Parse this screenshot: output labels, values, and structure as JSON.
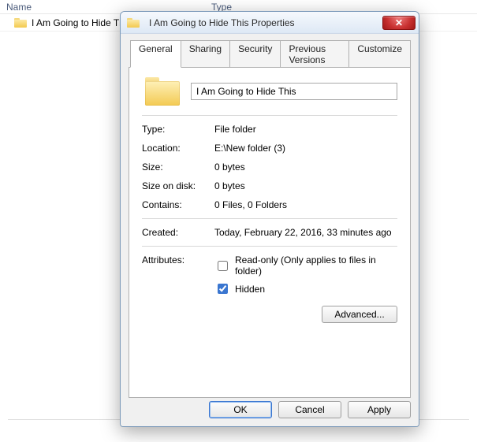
{
  "explorer": {
    "columns": {
      "name": "Name",
      "type": "Type"
    },
    "row": {
      "name": "I Am Going to Hide This"
    }
  },
  "dialog": {
    "title": "I Am Going to Hide This Properties",
    "tabs": [
      "General",
      "Sharing",
      "Security",
      "Previous Versions",
      "Customize"
    ],
    "active_tab": 0,
    "name_value": "I Am Going to Hide This",
    "type_label": "Type:",
    "type_value": "File folder",
    "location_label": "Location:",
    "location_value": "E:\\New folder (3)",
    "size_label": "Size:",
    "size_value": "0 bytes",
    "size_on_disk_label": "Size on disk:",
    "size_on_disk_value": "0 bytes",
    "contains_label": "Contains:",
    "contains_value": "0 Files, 0 Folders",
    "created_label": "Created:",
    "created_value": "Today, February 22, 2016, 33 minutes ago",
    "attributes_label": "Attributes:",
    "readonly_label": "Read-only (Only applies to files in folder)",
    "readonly_checked": false,
    "hidden_label": "Hidden",
    "hidden_checked": true,
    "advanced_label": "Advanced...",
    "ok_label": "OK",
    "cancel_label": "Cancel",
    "apply_label": "Apply"
  }
}
